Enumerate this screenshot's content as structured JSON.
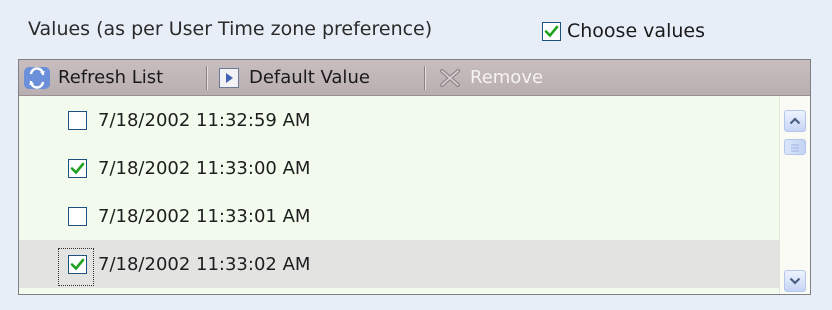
{
  "header": {
    "label": "Values (as per User Time zone preference)",
    "choose_values_label": "Choose values",
    "choose_values_checked": true
  },
  "toolbar": {
    "refresh_label": "Refresh List",
    "default_label": "Default Value",
    "remove_label": "Remove"
  },
  "values": [
    {
      "label": "7/18/2002 11:32:59 AM",
      "checked": false
    },
    {
      "label": "7/18/2002 11:33:00 AM",
      "checked": true
    },
    {
      "label": "7/18/2002 11:33:01 AM",
      "checked": false
    },
    {
      "label": "7/18/2002 11:33:02 AM",
      "checked": true,
      "selected": true
    }
  ],
  "colors": {
    "checkmark": "#21a121",
    "checkbox_border": "#1c5180",
    "toolbar_bg": "#bfb5b7",
    "list_bg": "#f2fbee",
    "selected_row_bg": "#e3e3e2"
  },
  "icons": {
    "refresh": "refresh-icon",
    "default": "play-icon",
    "remove": "remove-x-icon",
    "scroll_up": "chevron-up-icon",
    "scroll_down": "chevron-down-icon"
  }
}
